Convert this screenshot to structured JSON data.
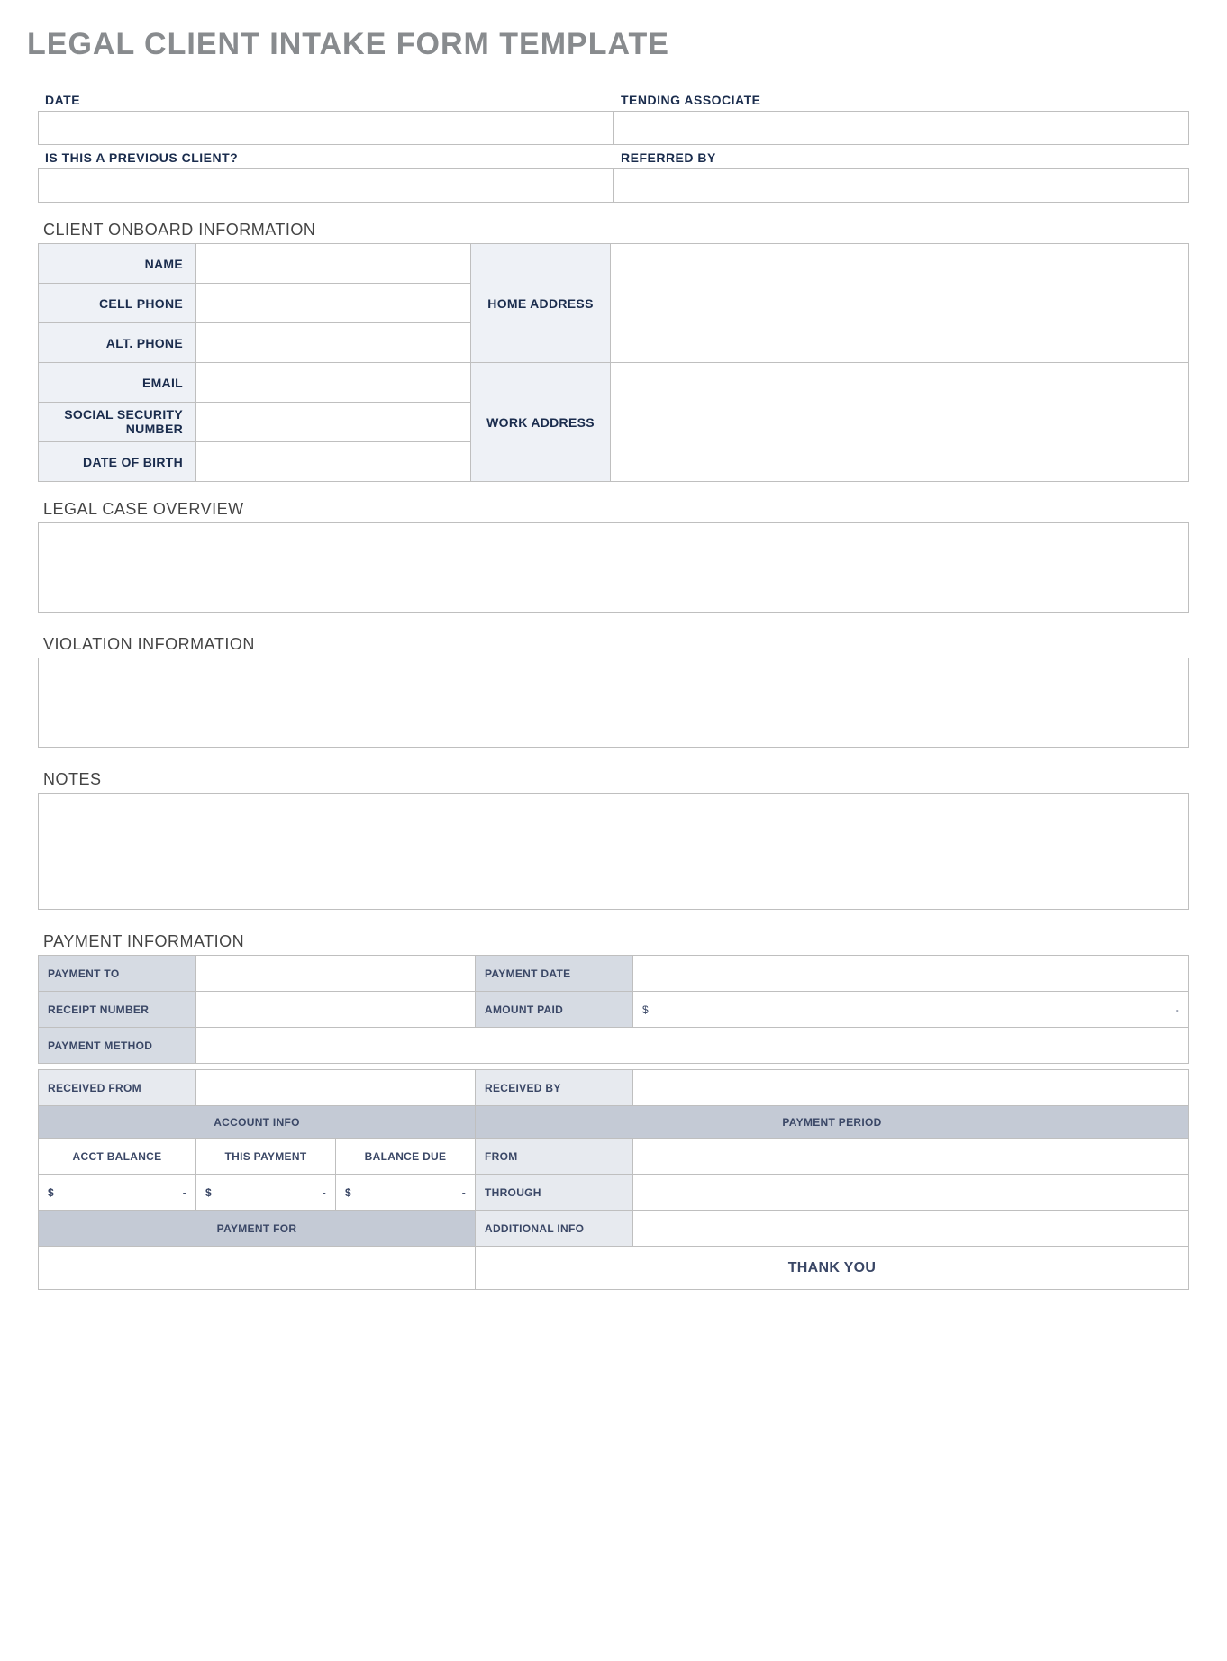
{
  "title": "LEGAL CLIENT INTAKE FORM TEMPLATE",
  "header": {
    "date_label": "DATE",
    "date_value": "",
    "associate_label": "TENDING ASSOCIATE",
    "associate_value": "",
    "previous_label": "IS THIS A PREVIOUS CLIENT?",
    "previous_value": "",
    "referred_label": "REFERRED BY",
    "referred_value": ""
  },
  "onboard": {
    "heading": "CLIENT ONBOARD INFORMATION",
    "name_label": "NAME",
    "name_value": "",
    "cell_label": "CELL PHONE",
    "cell_value": "",
    "alt_label": "ALT. PHONE",
    "alt_value": "",
    "email_label": "EMAIL",
    "email_value": "",
    "ssn_label": "SOCIAL SECURITY NUMBER",
    "ssn_value": "",
    "dob_label": "DATE OF BIRTH",
    "dob_value": "",
    "home_addr_label": "HOME ADDRESS",
    "home_addr_value": "",
    "work_addr_label": "WORK ADDRESS",
    "work_addr_value": ""
  },
  "overview": {
    "heading": "LEGAL CASE OVERVIEW",
    "value": ""
  },
  "violation": {
    "heading": "VIOLATION INFORMATION",
    "value": ""
  },
  "notes": {
    "heading": "NOTES",
    "value": ""
  },
  "payment": {
    "heading": "PAYMENT INFORMATION",
    "payment_to_label": "PAYMENT TO",
    "payment_to_value": "",
    "payment_date_label": "PAYMENT DATE",
    "payment_date_value": "",
    "receipt_label": "RECEIPT NUMBER",
    "receipt_value": "",
    "amount_paid_label": "AMOUNT PAID",
    "amount_paid_currency": "$",
    "amount_paid_value": "-",
    "method_label": "PAYMENT METHOD",
    "method_value": "",
    "received_from_label": "RECEIVED FROM",
    "received_from_value": "",
    "received_by_label": "RECEIVED BY",
    "received_by_value": "",
    "account_info_header": "ACCOUNT INFO",
    "payment_period_header": "PAYMENT PERIOD",
    "acct_balance_label": "ACCT BALANCE",
    "this_payment_label": "THIS PAYMENT",
    "balance_due_label": "BALANCE DUE",
    "from_label": "FROM",
    "from_value": "",
    "through_label": "THROUGH",
    "through_value": "",
    "acct_balance_currency": "$",
    "acct_balance_value": "-",
    "this_payment_currency": "$",
    "this_payment_value": "-",
    "balance_due_currency": "$",
    "balance_due_value": "-",
    "payment_for_label": "PAYMENT FOR",
    "payment_for_value": "",
    "additional_info_label": "ADDITIONAL INFO",
    "additional_info_value": "",
    "thank_you": "THANK YOU"
  }
}
